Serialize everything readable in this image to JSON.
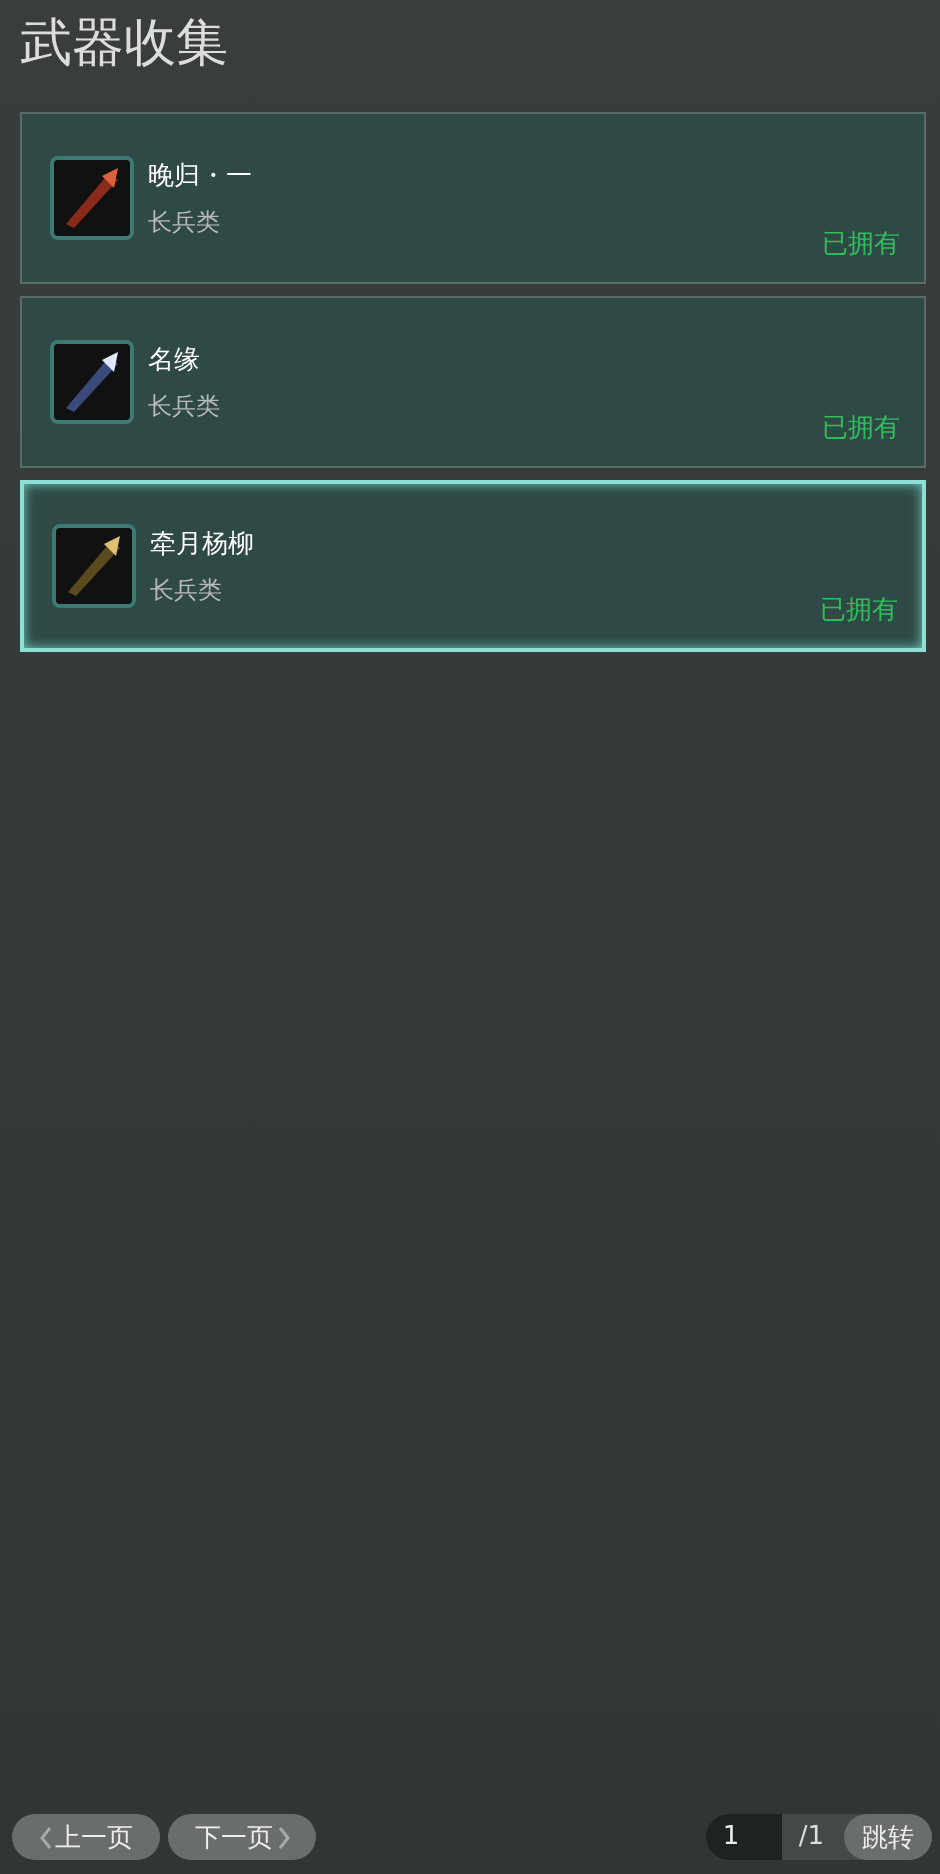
{
  "title": "武器收集",
  "weapons": [
    {
      "name": "晚归・一",
      "category": "长兵类",
      "status": "已拥有",
      "selected": false
    },
    {
      "name": "名缘",
      "category": "长兵类",
      "status": "已拥有",
      "selected": false
    },
    {
      "name": "牵月杨柳",
      "category": "长兵类",
      "status": "已拥有",
      "selected": true
    }
  ],
  "pager": {
    "prev": "上一页",
    "next": "下一页",
    "page": "1",
    "total": "/1",
    "jump": "跳转"
  }
}
